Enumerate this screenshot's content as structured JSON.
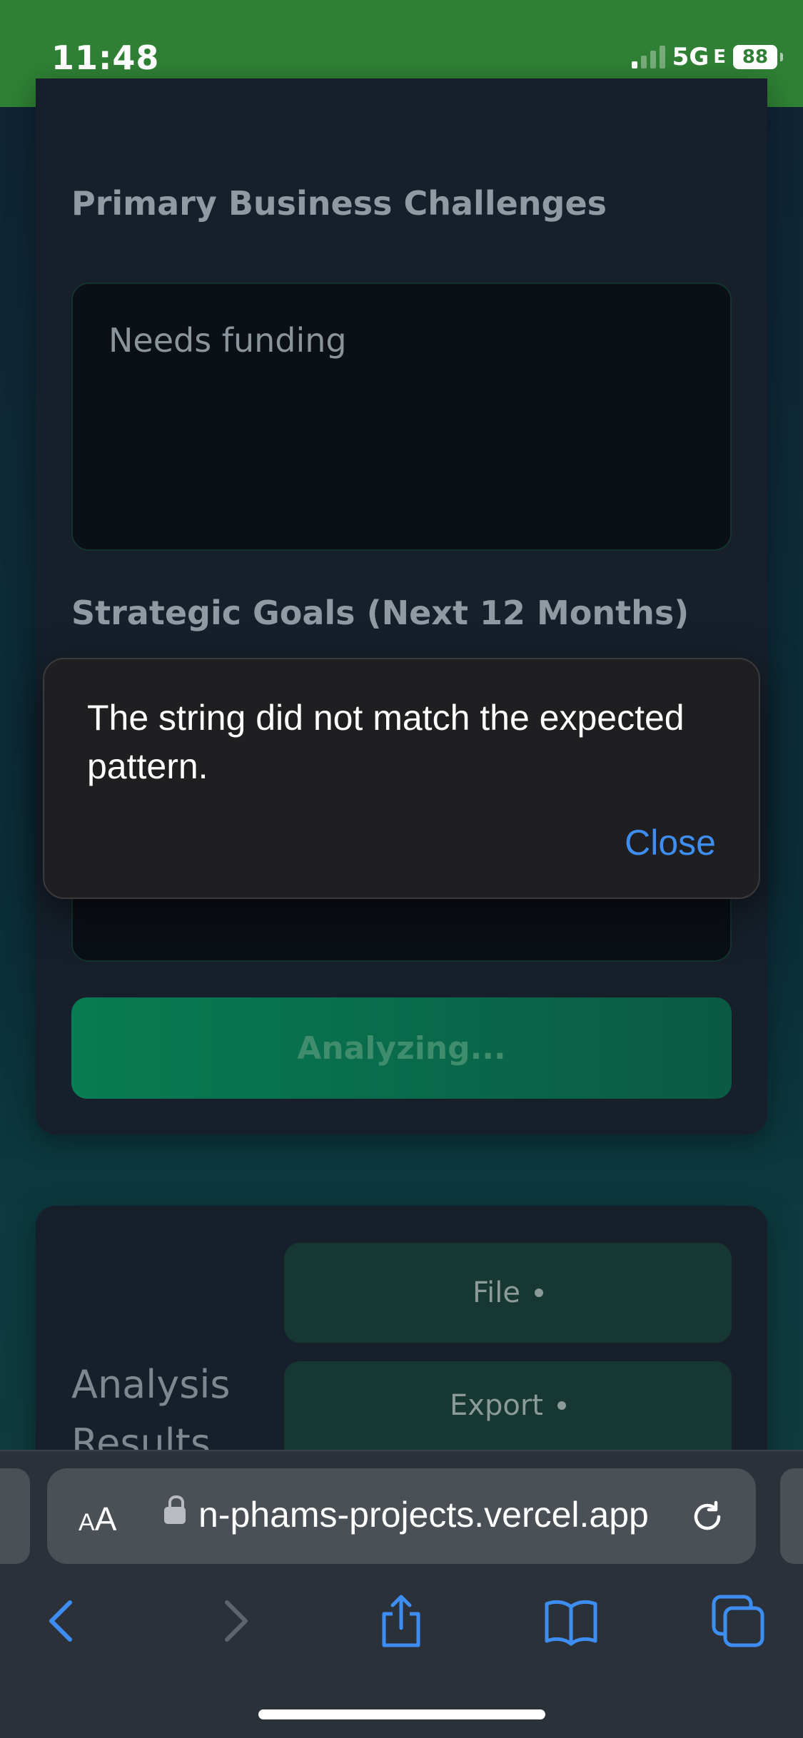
{
  "status_bar": {
    "time": "11:48",
    "network": "5G",
    "network_suffix": "E",
    "battery": "88"
  },
  "form": {
    "challenges_label": "Primary Business Challenges",
    "challenges_value": "Needs funding",
    "goals_label": "Strategic Goals (Next 12 Months)",
    "submit_label": "Analyzing..."
  },
  "results": {
    "title": "Analysis Results",
    "file_label": "File",
    "export_label": "Export"
  },
  "alert": {
    "message": "The string did not match the expected pattern.",
    "close_label": "Close"
  },
  "browser": {
    "aa_small": "A",
    "aa_big": "A",
    "url": "n-phams-projects.vercel.app"
  },
  "colors": {
    "status_bar": "#2f8034",
    "accent_link": "#3e8ef2",
    "button_green": "#087c52"
  }
}
